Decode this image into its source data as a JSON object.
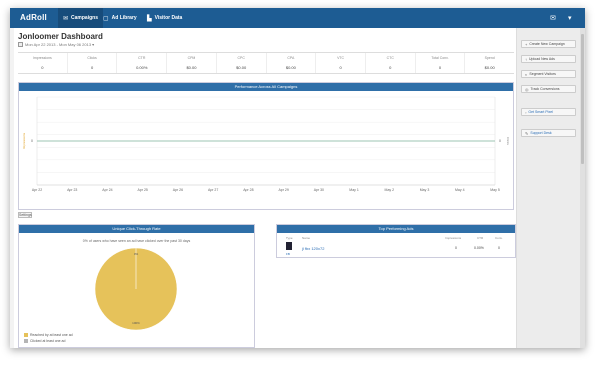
{
  "app": {
    "logo": "AdRoll"
  },
  "nav": {
    "items": [
      {
        "label": "Campaigns",
        "icon": "megaphone-icon",
        "glyph": "✉"
      },
      {
        "label": "Ad Library",
        "icon": "library-icon",
        "glyph": "▢"
      },
      {
        "label": "Visitor Data",
        "icon": "chart-icon",
        "glyph": "▙"
      }
    ],
    "right_icons": [
      {
        "icon": "mail-icon",
        "glyph": "✉"
      },
      {
        "icon": "user-icon",
        "glyph": "▾"
      }
    ]
  },
  "dashboard": {
    "title": "Jonloomer Dashboard",
    "date_range": "Mon Apr 22 2013 - Mon May 06 2013 ▾"
  },
  "stats": [
    {
      "label": "Impressions",
      "value": "0"
    },
    {
      "label": "Clicks",
      "value": "0"
    },
    {
      "label": "CTR",
      "value": "0.00%"
    },
    {
      "label": "CPM",
      "value": "$0.00"
    },
    {
      "label": "CPC",
      "value": "$0.00"
    },
    {
      "label": "CPA",
      "value": "$0.00"
    },
    {
      "label": "VTC",
      "value": "0"
    },
    {
      "label": "CTC",
      "value": "0"
    },
    {
      "label": "Total Conv.",
      "value": "0"
    },
    {
      "label": "Spend",
      "value": "$0.00"
    }
  ],
  "performance": {
    "title": "Performance Across All Campaigns",
    "settings_label": "Settings"
  },
  "chart_data": [
    {
      "type": "line",
      "title": "Performance Across All Campaigns",
      "x": [
        "Apr 22",
        "Apr 23",
        "Apr 24",
        "Apr 25",
        "Apr 26",
        "Apr 27",
        "Apr 28",
        "Apr 29",
        "Apr 30",
        "May 1",
        "May 2",
        "May 3",
        "May 4",
        "May 5"
      ],
      "series": [
        {
          "name": "",
          "values": [
            0,
            0,
            0,
            0,
            0,
            0,
            0,
            0,
            0,
            0,
            0,
            0,
            0,
            0
          ],
          "color": "#9ec6b3"
        }
      ],
      "y_left_tick": "0",
      "y_right_tick": "0",
      "ylabel": "Impressions",
      "y2label": "Clicks",
      "grid": true
    },
    {
      "type": "pie",
      "title": "Unique Click-Through Rate",
      "slices": [
        {
          "name": "Reached by at least one ad",
          "value": 100,
          "color": "#e6c25a"
        },
        {
          "name": "Clicked at least one ad",
          "value": 0,
          "color": "#b5b5b5"
        }
      ],
      "annotation": "0% of users who have seen an ad have clicked over the past 30 days",
      "top_label": "0%",
      "bottom_label": "100%"
    }
  ],
  "top_ads": {
    "title": "Top Performing Ads",
    "columns": [
      "Type",
      "Name",
      "Impressions",
      "CTR",
      "Conv."
    ],
    "rows": [
      {
        "type": "FB",
        "name": "jl fbx 120x72",
        "impressions": "0",
        "ctr": "0.00%",
        "conv": "0"
      }
    ]
  },
  "sidebar": {
    "buttons": [
      {
        "label": "Create New Campaign",
        "icon": "plus-icon",
        "glyph": "+"
      },
      {
        "label": "Upload New Ads",
        "icon": "upload-icon",
        "glyph": "↑"
      },
      {
        "label": "Segment Visitors",
        "icon": "segment-icon",
        "glyph": "◐"
      },
      {
        "label": "Track Conversions",
        "icon": "target-icon",
        "glyph": "◎"
      }
    ],
    "get_smart_pixel": "Get Smart Pixel",
    "support_label": "Support Desk"
  }
}
